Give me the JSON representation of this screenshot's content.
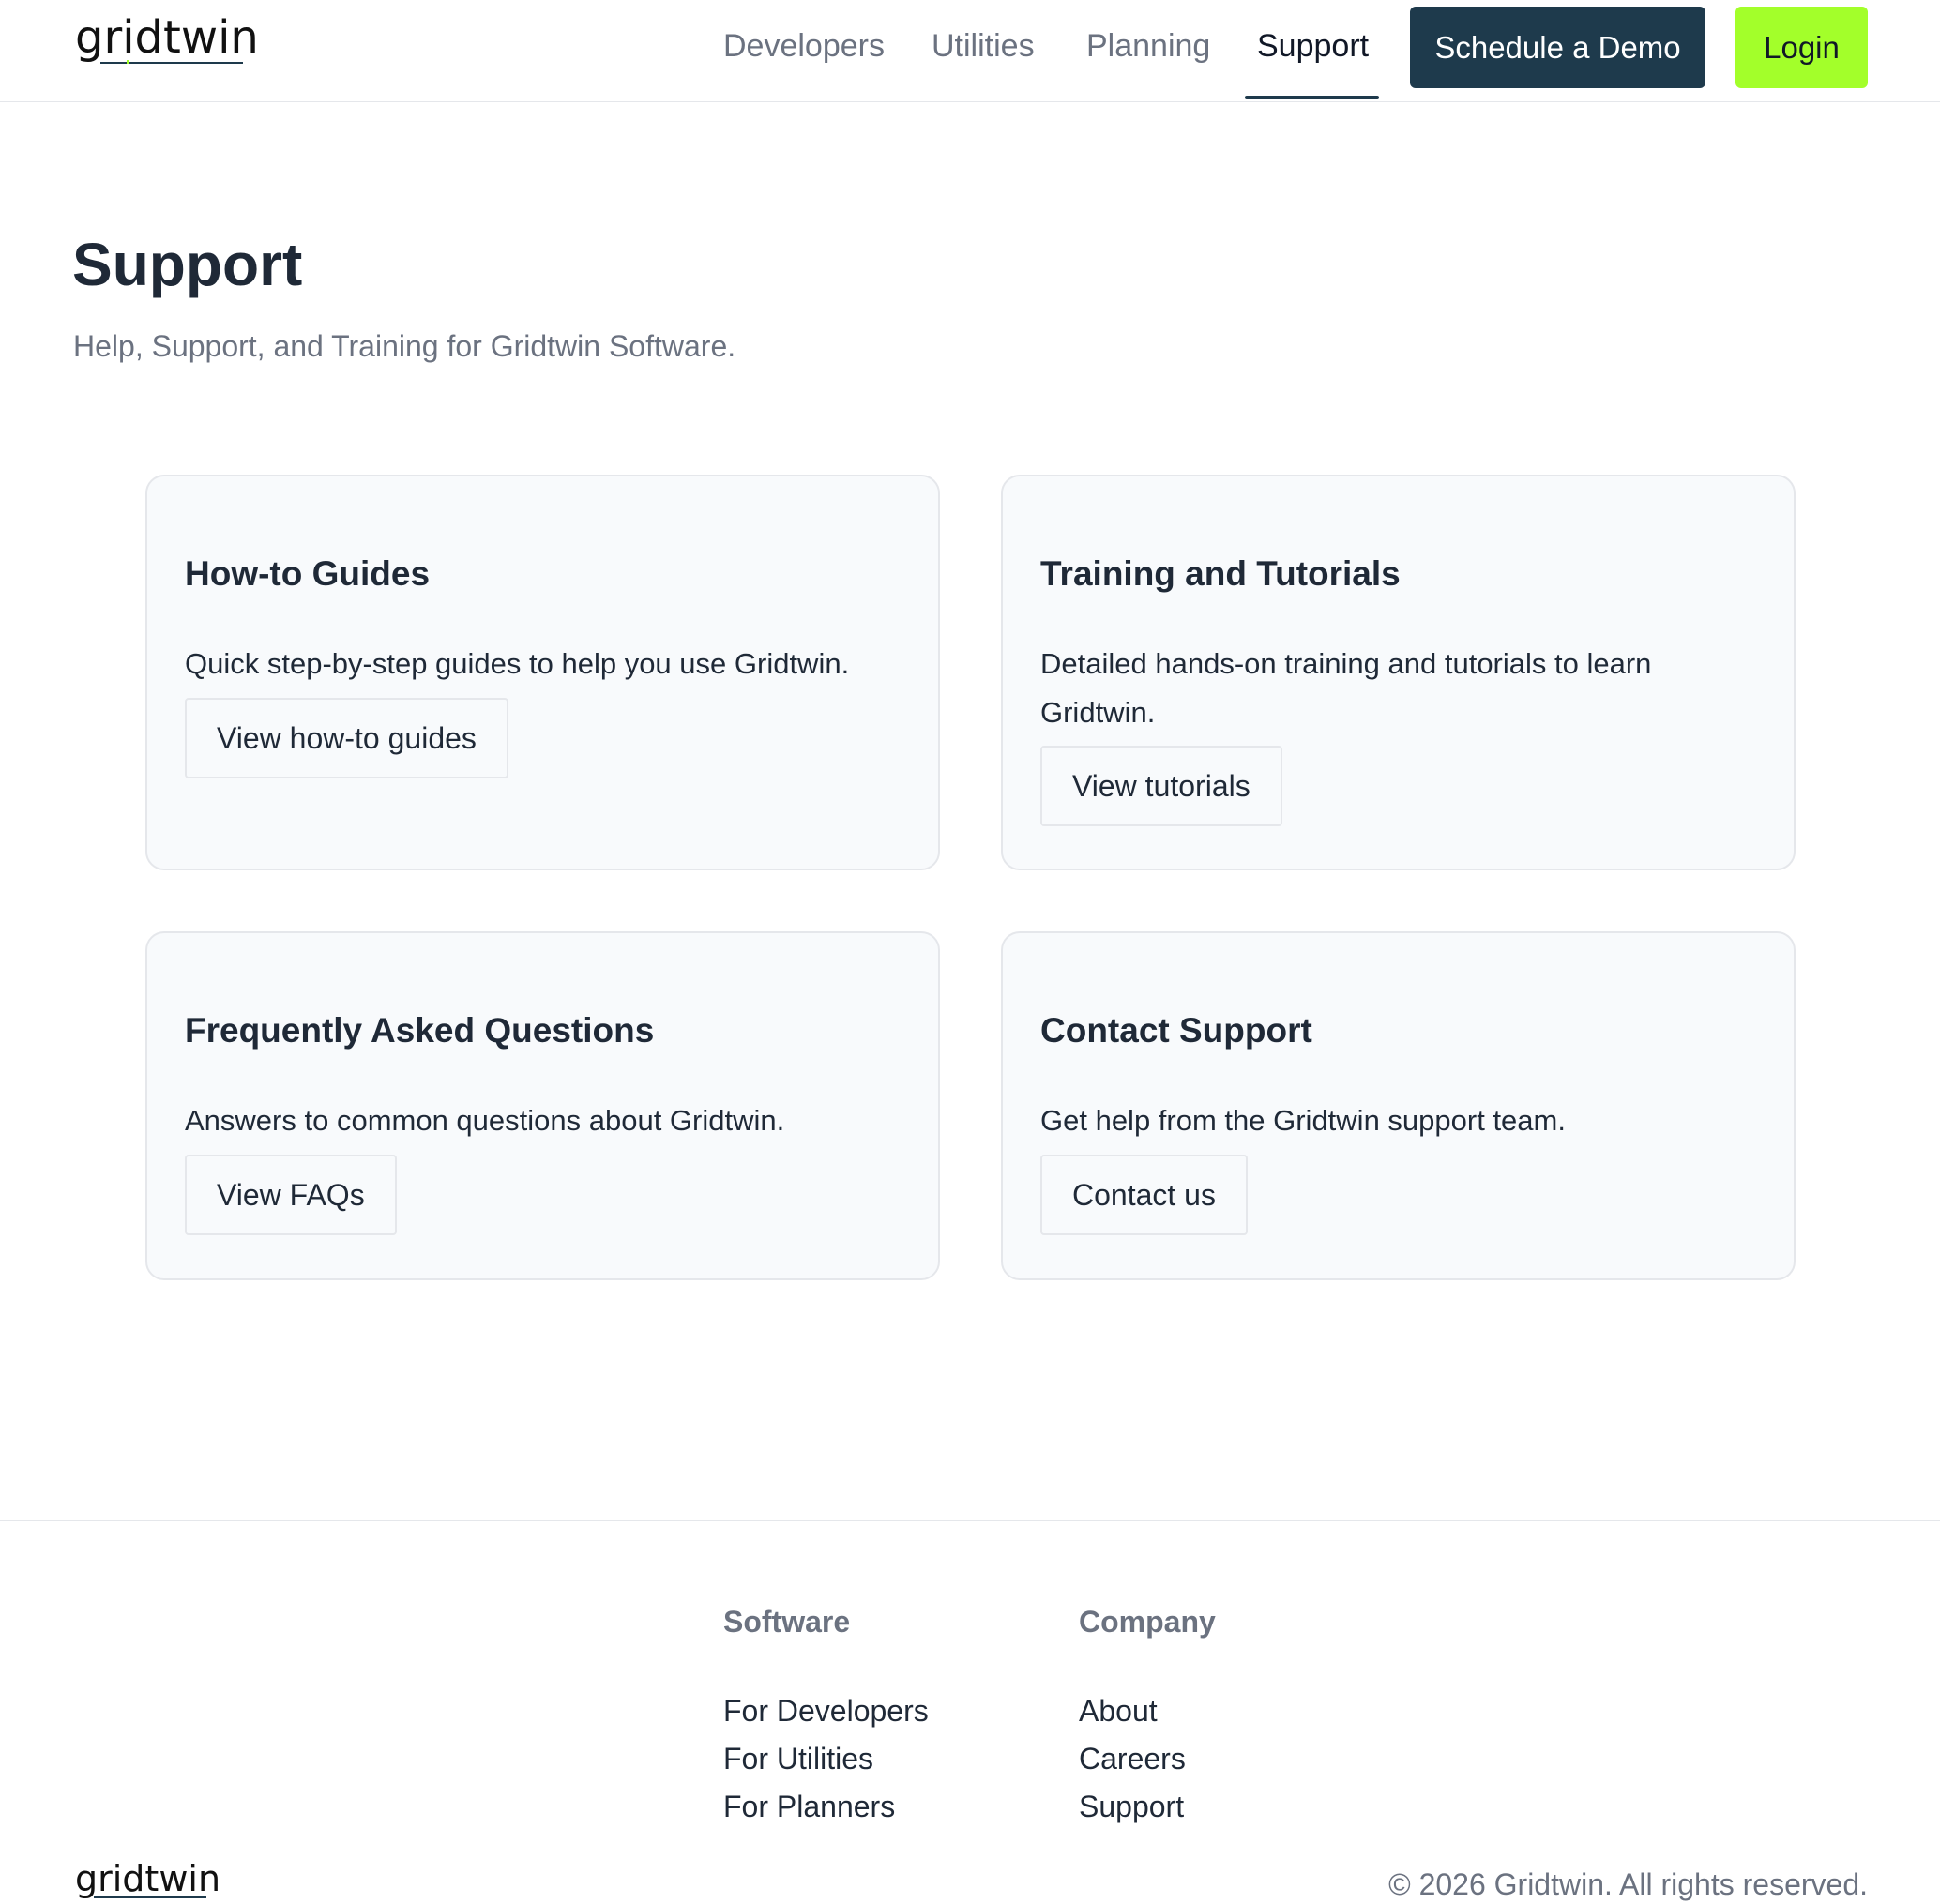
{
  "brand": {
    "logo_text": "gridtwin"
  },
  "nav": {
    "items": [
      {
        "label": "Developers"
      },
      {
        "label": "Utilities"
      },
      {
        "label": "Planning"
      },
      {
        "label": "Support"
      }
    ],
    "active": "Support",
    "demo_label": "Schedule a Demo",
    "login_label": "Login"
  },
  "hero": {
    "title": "Support",
    "subtitle": "Help, Support, and Training for Gridtwin Software."
  },
  "cards": [
    {
      "title": "How-to Guides",
      "description": "Quick step-by-step guides to help you use Gridtwin.",
      "button": "View how-to guides"
    },
    {
      "title": "Training and Tutorials",
      "description": "Detailed hands-on training and tutorials to learn Gridtwin.",
      "button": "View tutorials"
    },
    {
      "title": "Frequently Asked Questions",
      "description": "Answers to common questions about Gridtwin.",
      "button": "View FAQs"
    },
    {
      "title": "Contact Support",
      "description": "Get help from the Gridtwin support team.",
      "button": "Contact us"
    }
  ],
  "footer": {
    "columns": [
      {
        "heading": "Software",
        "links": [
          "For Developers",
          "For Utilities",
          "For Planners"
        ]
      },
      {
        "heading": "Company",
        "links": [
          "About",
          "Careers",
          "Support"
        ]
      }
    ],
    "copyright": "© 2026 Gridtwin. All rights reserved."
  },
  "colors": {
    "primary": "#1e3a4c",
    "accent": "#a3ff2a",
    "text": "#1f2937",
    "muted": "#6b7280",
    "card_bg": "#f8fafc",
    "border": "#e5e7eb"
  }
}
